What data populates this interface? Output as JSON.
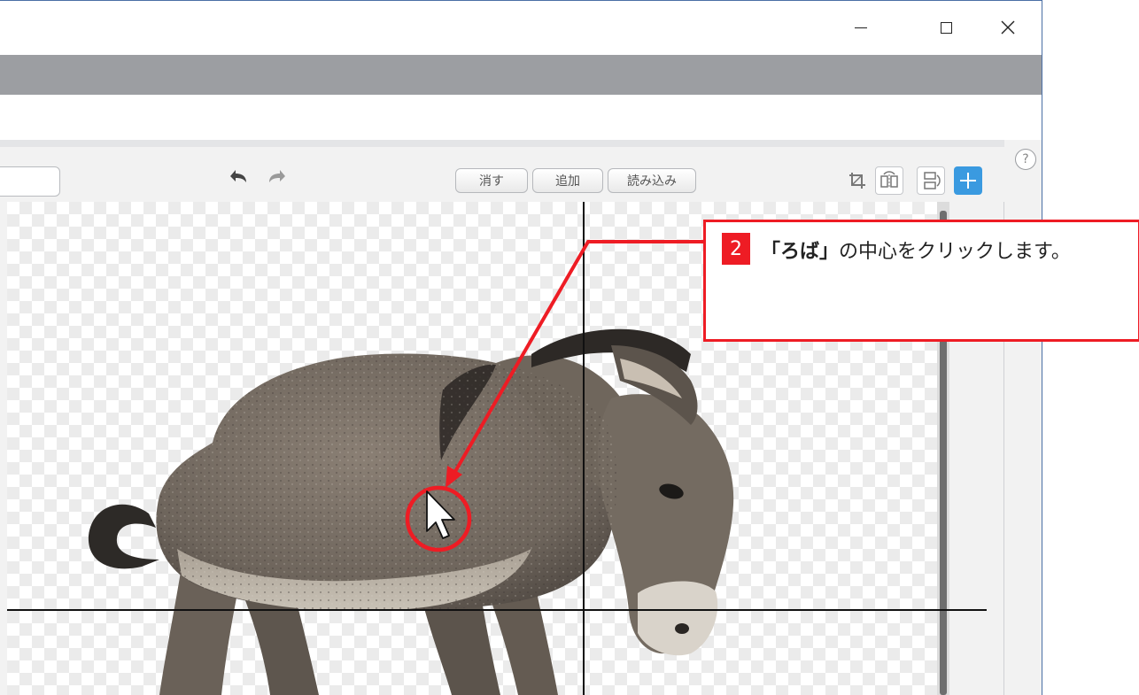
{
  "window": {
    "controls": {
      "minimize": "minimize",
      "maximize": "maximize",
      "close": "close"
    }
  },
  "toolbar": {
    "clear_label": "消す",
    "add_label": "追加",
    "import_label": "読み込み"
  },
  "tool_icons": [
    "crop-icon",
    "flip-horizontal-icon",
    "flip-vertical-icon",
    "set-center-icon"
  ],
  "help": {
    "label": "?"
  },
  "callout": {
    "step_number": "2",
    "text_bold": "「ろば」",
    "text_rest": "の中心をクリックします。"
  },
  "colors": {
    "accent_red": "#ee1c24",
    "center_button_blue": "#3a9ae0",
    "menubar_gray": "#9c9ea2"
  }
}
